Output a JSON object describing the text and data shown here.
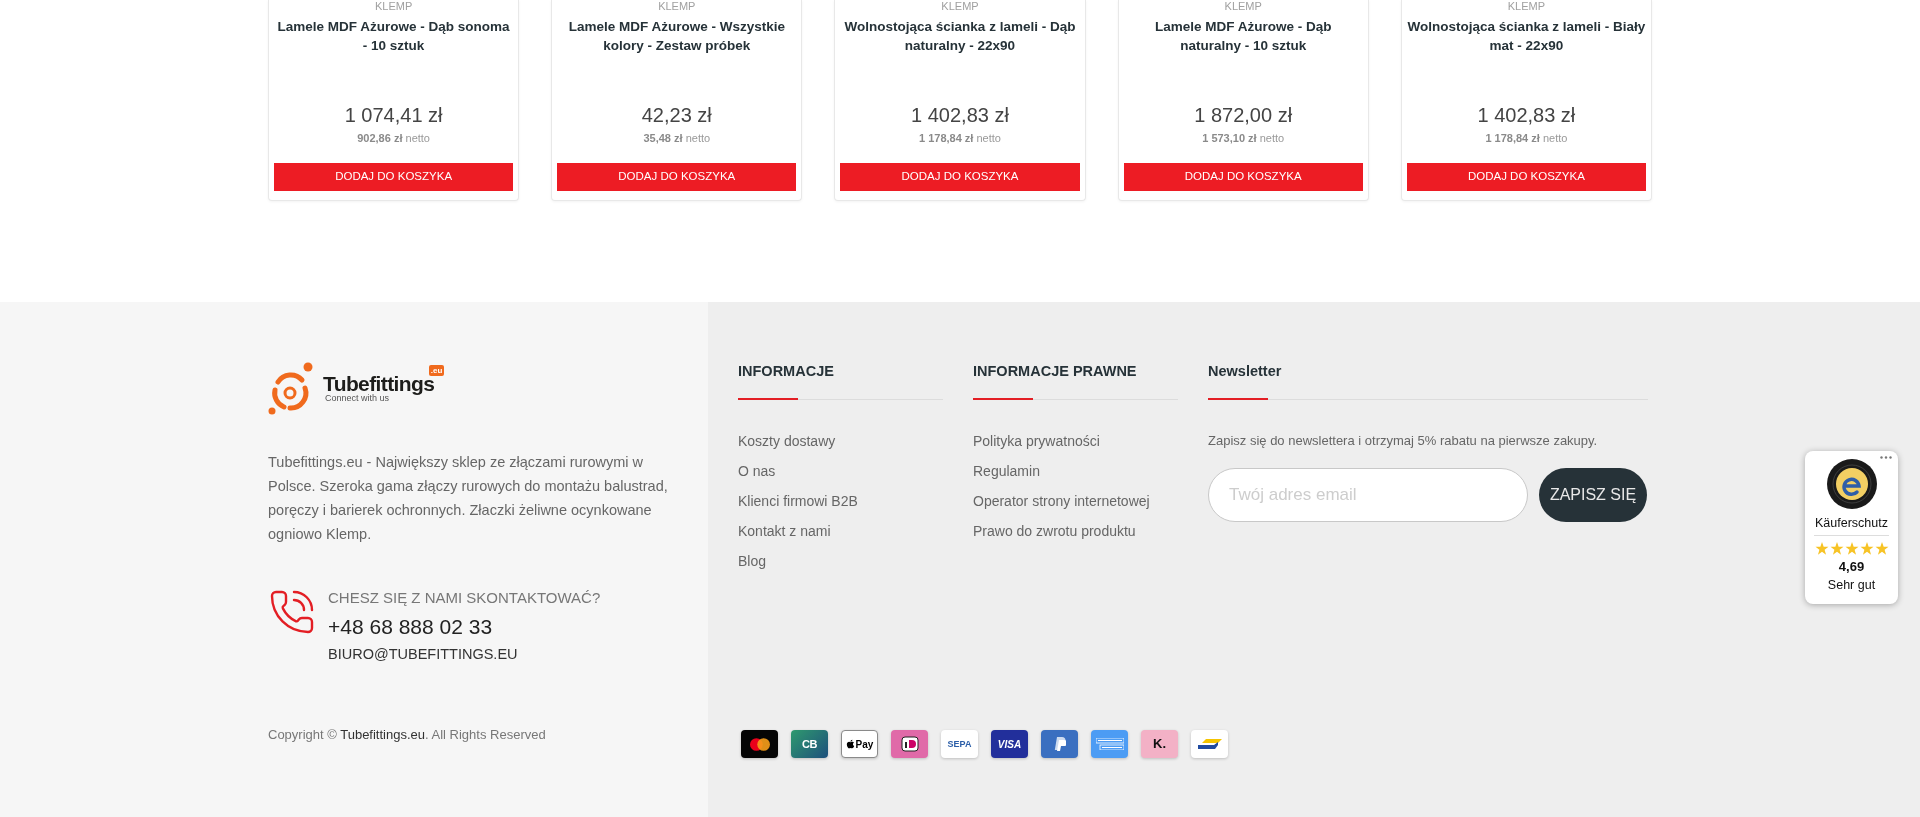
{
  "products": [
    {
      "brand": "KLEMP",
      "name": "Lamele MDF Ażurowe - Dąb sonoma - 10 sztuk",
      "price": "1 074,41 zł",
      "net_price": "**902,86 zł** netto",
      "button": "DODAJ DO KOSZYKA"
    },
    {
      "brand": "KLEMP",
      "name": "Lamele MDF Ażurowe - Wszystkie kolory - Zestaw próbek",
      "price": "42,23 zł",
      "net_price": "**35,48 zł** netto",
      "button": "DODAJ DO KOSZYKA"
    },
    {
      "brand": "KLEMP",
      "name": "Wolnostojąca ścianka z lameli - Dąb naturalny - 22x90",
      "price": "1 402,83 zł",
      "net_price": "**1 178,84 zł** netto",
      "button": "DODAJ DO KOSZYKA"
    },
    {
      "brand": "KLEMP",
      "name": "Lamele MDF Ażurowe - Dąb naturalny - 10 sztuk",
      "price": "1 872,00 zł",
      "net_price": "**1 573,10 zł** netto",
      "button": "DODAJ DO KOSZYKA"
    },
    {
      "brand": "KLEMP",
      "name": "Wolnostojąca ścianka z lameli - Biały mat - 22x90",
      "price": "1 402,83 zł",
      "net_price": "**1 178,84 zł** netto",
      "button": "DODAJ DO KOSZYKA"
    }
  ],
  "footer": {
    "logo": {
      "name": "Tubefittings",
      "domain": ".eu",
      "tagline": "Connect with us"
    },
    "description": "Tubefittings.eu - Największy sklep ze złączami rurowymi w Polsce. Szeroka gama złączy rurowych do montażu balustrad, poręczy i barierek ochronnych. Złaczki żeliwne ocynkowane ogniowo Klemp.",
    "contact": {
      "heading": "CHESZ SIĘ Z NAMI SKONTAKTOWAĆ?",
      "phone": "+48 68 888 02 33",
      "email": "BIURO@TUBEFITTINGS.EU"
    },
    "copyright": {
      "prefix": "Copyright ©",
      "link": "Tubefittings.eu",
      "suffix": ". All Rights Reserved"
    },
    "columns": [
      {
        "title": "INFORMACJE",
        "links": [
          "Koszty dostawy",
          "O nas",
          "Klienci firmowi B2B",
          "Kontakt z nami",
          "Blog"
        ]
      },
      {
        "title": "INFORMACJE PRAWNE",
        "links": [
          "Polityka prywatności",
          "Regulamin",
          "Operator strony internetowej",
          "Prawo do zwrotu produktu"
        ]
      }
    ],
    "newsletter": {
      "title": "Newsletter",
      "text": "Zapisz się do newslettera i otrzymaj 5% rabatu na pierwsze zakupy.",
      "placeholder": "Twój adres email",
      "button": "ZAPISZ SIĘ"
    },
    "payment_methods": [
      {
        "kind": "mastercard"
      },
      {
        "kind": "cb",
        "label": "CB"
      },
      {
        "kind": "applepay",
        "label": "Pay"
      },
      {
        "kind": "ideal"
      },
      {
        "kind": "sepa",
        "label": "SEPA"
      },
      {
        "kind": "visa",
        "label": "VISA"
      },
      {
        "kind": "paypal"
      },
      {
        "kind": "amex"
      },
      {
        "kind": "klarna",
        "label": "K."
      },
      {
        "kind": "swoosh"
      }
    ]
  },
  "trust_badge": {
    "title": "Käuferschutz",
    "stars": 5,
    "rating": "4,69",
    "verdict": "Sehr gut"
  }
}
